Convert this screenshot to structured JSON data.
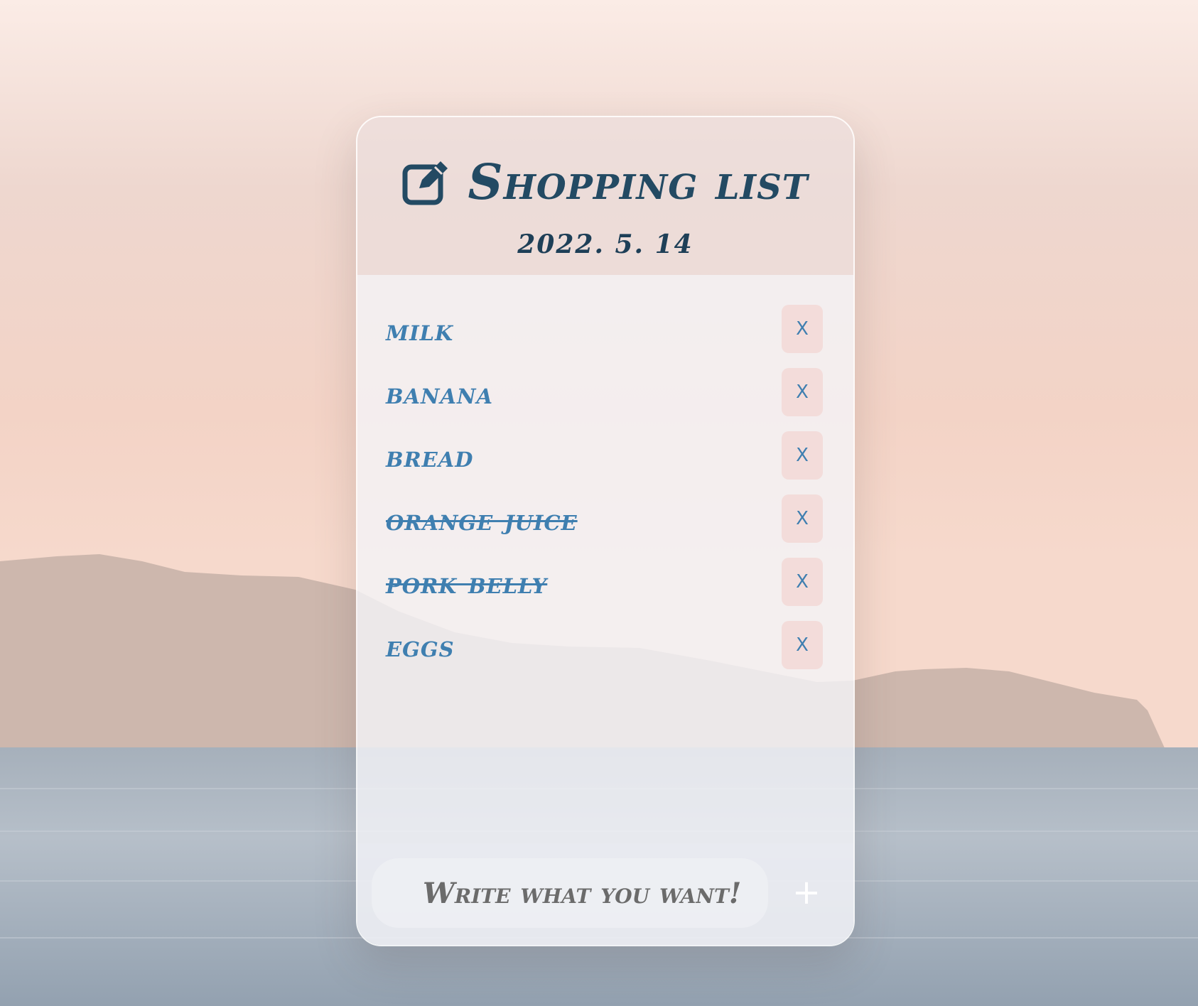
{
  "header": {
    "title": "Shopping list",
    "date": "2022. 5. 14",
    "icon": "edit-icon"
  },
  "list": {
    "items": [
      {
        "label": "milk",
        "done": false,
        "delete_label": "X"
      },
      {
        "label": "banana",
        "done": false,
        "delete_label": "X"
      },
      {
        "label": "bread",
        "done": false,
        "delete_label": "X"
      },
      {
        "label": "orange juice",
        "done": true,
        "delete_label": "X"
      },
      {
        "label": "pork belly",
        "done": true,
        "delete_label": "X"
      },
      {
        "label": "eggs",
        "done": false,
        "delete_label": "X"
      }
    ]
  },
  "footer": {
    "input_placeholder": "Write what you want!",
    "add_label": "+"
  },
  "colors": {
    "title": "#234a63",
    "item_text": "#3f7fb0",
    "delete_bg": "#f3dcda"
  }
}
